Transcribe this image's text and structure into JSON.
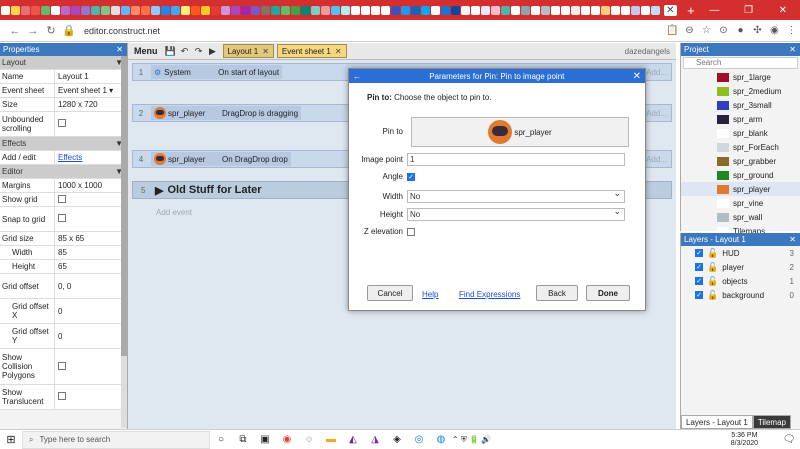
{
  "browser": {
    "url": "editor.construct.net",
    "new_tab": "+",
    "tab_colors": [
      "#ffffff",
      "#ffd54f",
      "#e57373",
      "#ef5350",
      "#66bb6a",
      "#ffffff",
      "#ba68c8",
      "#ab47bc",
      "#9575cd",
      "#4db6ac",
      "#81c784",
      "#e0e0e0",
      "#64b5f6",
      "#ff8a65",
      "#ff7043",
      "#90caf9",
      "#1e88e5",
      "#42a5f5",
      "#fff176",
      "#ff5722",
      "#ffca28",
      "#e53935",
      "#ce93d8",
      "#ab47bc",
      "#9c27b0",
      "#7e57c2",
      "#8d6e63",
      "#26a69a",
      "#66bb6a",
      "#43a047",
      "#00897b",
      "#80cbc4",
      "#ef9a9a",
      "#4fc3f7",
      "#b2ebf2",
      "#ffffff",
      "#ffffff",
      "#ffffff",
      "#ffffff",
      "#3f51b5",
      "#2196f3",
      "#1565c0",
      "#03a9f4",
      "#ffffff",
      "#1976d2",
      "#0d47a1",
      "#f5f5f5",
      "#ffffff",
      "#e8eaf6",
      "#f8bbd0",
      "#4db6ac",
      "#ffffff",
      "#90a4ae",
      "#ffffff",
      "#b0bec5",
      "#ffffff",
      "#ffffff",
      "#eeeeee",
      "#ffffff",
      "#ffffff",
      "#ffcc80",
      "#ffffff",
      "#ffffff",
      "#c5cae9",
      "#ffffff",
      "#bbdefb"
    ]
  },
  "toolbar": {
    "menu": "Menu",
    "tabs": [
      {
        "label": "Layout 1",
        "active": false
      },
      {
        "label": "Event sheet 1",
        "active": true
      }
    ],
    "user": "dazedangels"
  },
  "properties": {
    "title": "Properties",
    "rows": [
      {
        "type": "section",
        "k": "Layout"
      },
      {
        "k": "Name",
        "v": "Layout 1"
      },
      {
        "k": "Event sheet",
        "v": "Event sheet 1 ▾"
      },
      {
        "k": "Size",
        "v": "1280 x 720"
      },
      {
        "k": "Unbounded scrolling",
        "v": "",
        "cb": false,
        "tall": 1
      },
      {
        "type": "section",
        "k": "Effects"
      },
      {
        "k": "Add / edit",
        "v": "Effects",
        "link": true
      },
      {
        "type": "section",
        "k": "Editor"
      },
      {
        "k": "Margins",
        "v": "1000 x 1000"
      },
      {
        "k": "Show grid",
        "v": "",
        "cb": false
      },
      {
        "k": "Snap to grid",
        "v": "",
        "cb": false,
        "tall": 1
      },
      {
        "k": "Grid size",
        "v": "85 x 65"
      },
      {
        "k": "Width",
        "v": "85",
        "indent": true
      },
      {
        "k": "Height",
        "v": "65",
        "indent": true
      },
      {
        "k": "Grid offset",
        "v": "0, 0",
        "tall": 1
      },
      {
        "k": "Grid offset X",
        "v": "0",
        "indent": true,
        "tall": 1
      },
      {
        "k": "Grid offset Y",
        "v": "0",
        "indent": true,
        "tall": 1
      },
      {
        "k": "Show Collision Polygons",
        "v": "",
        "cb": false,
        "tall": 2
      },
      {
        "k": "Show Translucent",
        "v": "",
        "cb": false,
        "tall": 1
      }
    ]
  },
  "events": [
    {
      "num": "1",
      "cond_icon": "gear",
      "cond_obj": "System",
      "cond_text": "On start of layout"
    },
    {
      "num": "2",
      "cond_icon": "robot",
      "cond_obj": "spr_player",
      "cond_text": "DragDrop is dragging"
    },
    {
      "num": "4",
      "cond_icon": "robot",
      "cond_obj": "spr_player",
      "cond_text": "On DragDrop drop"
    }
  ],
  "group_title": "Old Stuff for Later",
  "group_num": "5",
  "add_event": "Add event",
  "add_action": "Add...",
  "dialog": {
    "title": "Parameters for Pin: Pin to image point",
    "pin_to_bold": "Pin to:",
    "pin_to_desc": "Choose the object to pin to.",
    "pin_label": "Pin to",
    "pin_object": "spr_player",
    "image_point_label": "Image point",
    "image_point_value": "1",
    "angle_label": "Angle",
    "angle_checked": true,
    "width_label": "Width",
    "width_value": "No",
    "height_label": "Height",
    "height_value": "No",
    "z_label": "Z elevation",
    "z_checked": false,
    "cancel": "Cancel",
    "help": "Help",
    "find": "Find Expressions",
    "back": "Back",
    "done": "Done"
  },
  "project": {
    "title": "Project",
    "search_placeholder": "Search",
    "items": [
      {
        "name": "spr_1large",
        "color": "#a0102a"
      },
      {
        "name": "spr_2medium",
        "color": "#8fbf1f"
      },
      {
        "name": "spr_3small",
        "color": "#2f3fbf"
      },
      {
        "name": "spr_arm",
        "color": "#2a2040"
      },
      {
        "name": "spr_blank",
        "color": "#ffffff"
      },
      {
        "name": "spr_ForEach",
        "color": "#cfd8dc"
      },
      {
        "name": "spr_grabber",
        "color": "#8a6a2a"
      },
      {
        "name": "spr_ground",
        "color": "#1e8a1e"
      },
      {
        "name": "spr_player",
        "color": "#e07a2e"
      },
      {
        "name": "spr_vine",
        "color": "#ffffff"
      },
      {
        "name": "spr_wall",
        "color": "#b0bec5"
      },
      {
        "name": "Tilemaps",
        "color": "#ffffff"
      }
    ]
  },
  "layers": {
    "title": "Layers - Layout 1",
    "items": [
      {
        "name": "HUD",
        "n": "3"
      },
      {
        "name": "player",
        "n": "2"
      },
      {
        "name": "objects",
        "n": "1"
      },
      {
        "name": "background",
        "n": "0"
      }
    ],
    "tab1": "Layers - Layout 1",
    "tab2": "Tilemap"
  },
  "taskbar": {
    "search_placeholder": "Type here to search",
    "time": "5:36 PM",
    "date": "8/3/2020"
  }
}
